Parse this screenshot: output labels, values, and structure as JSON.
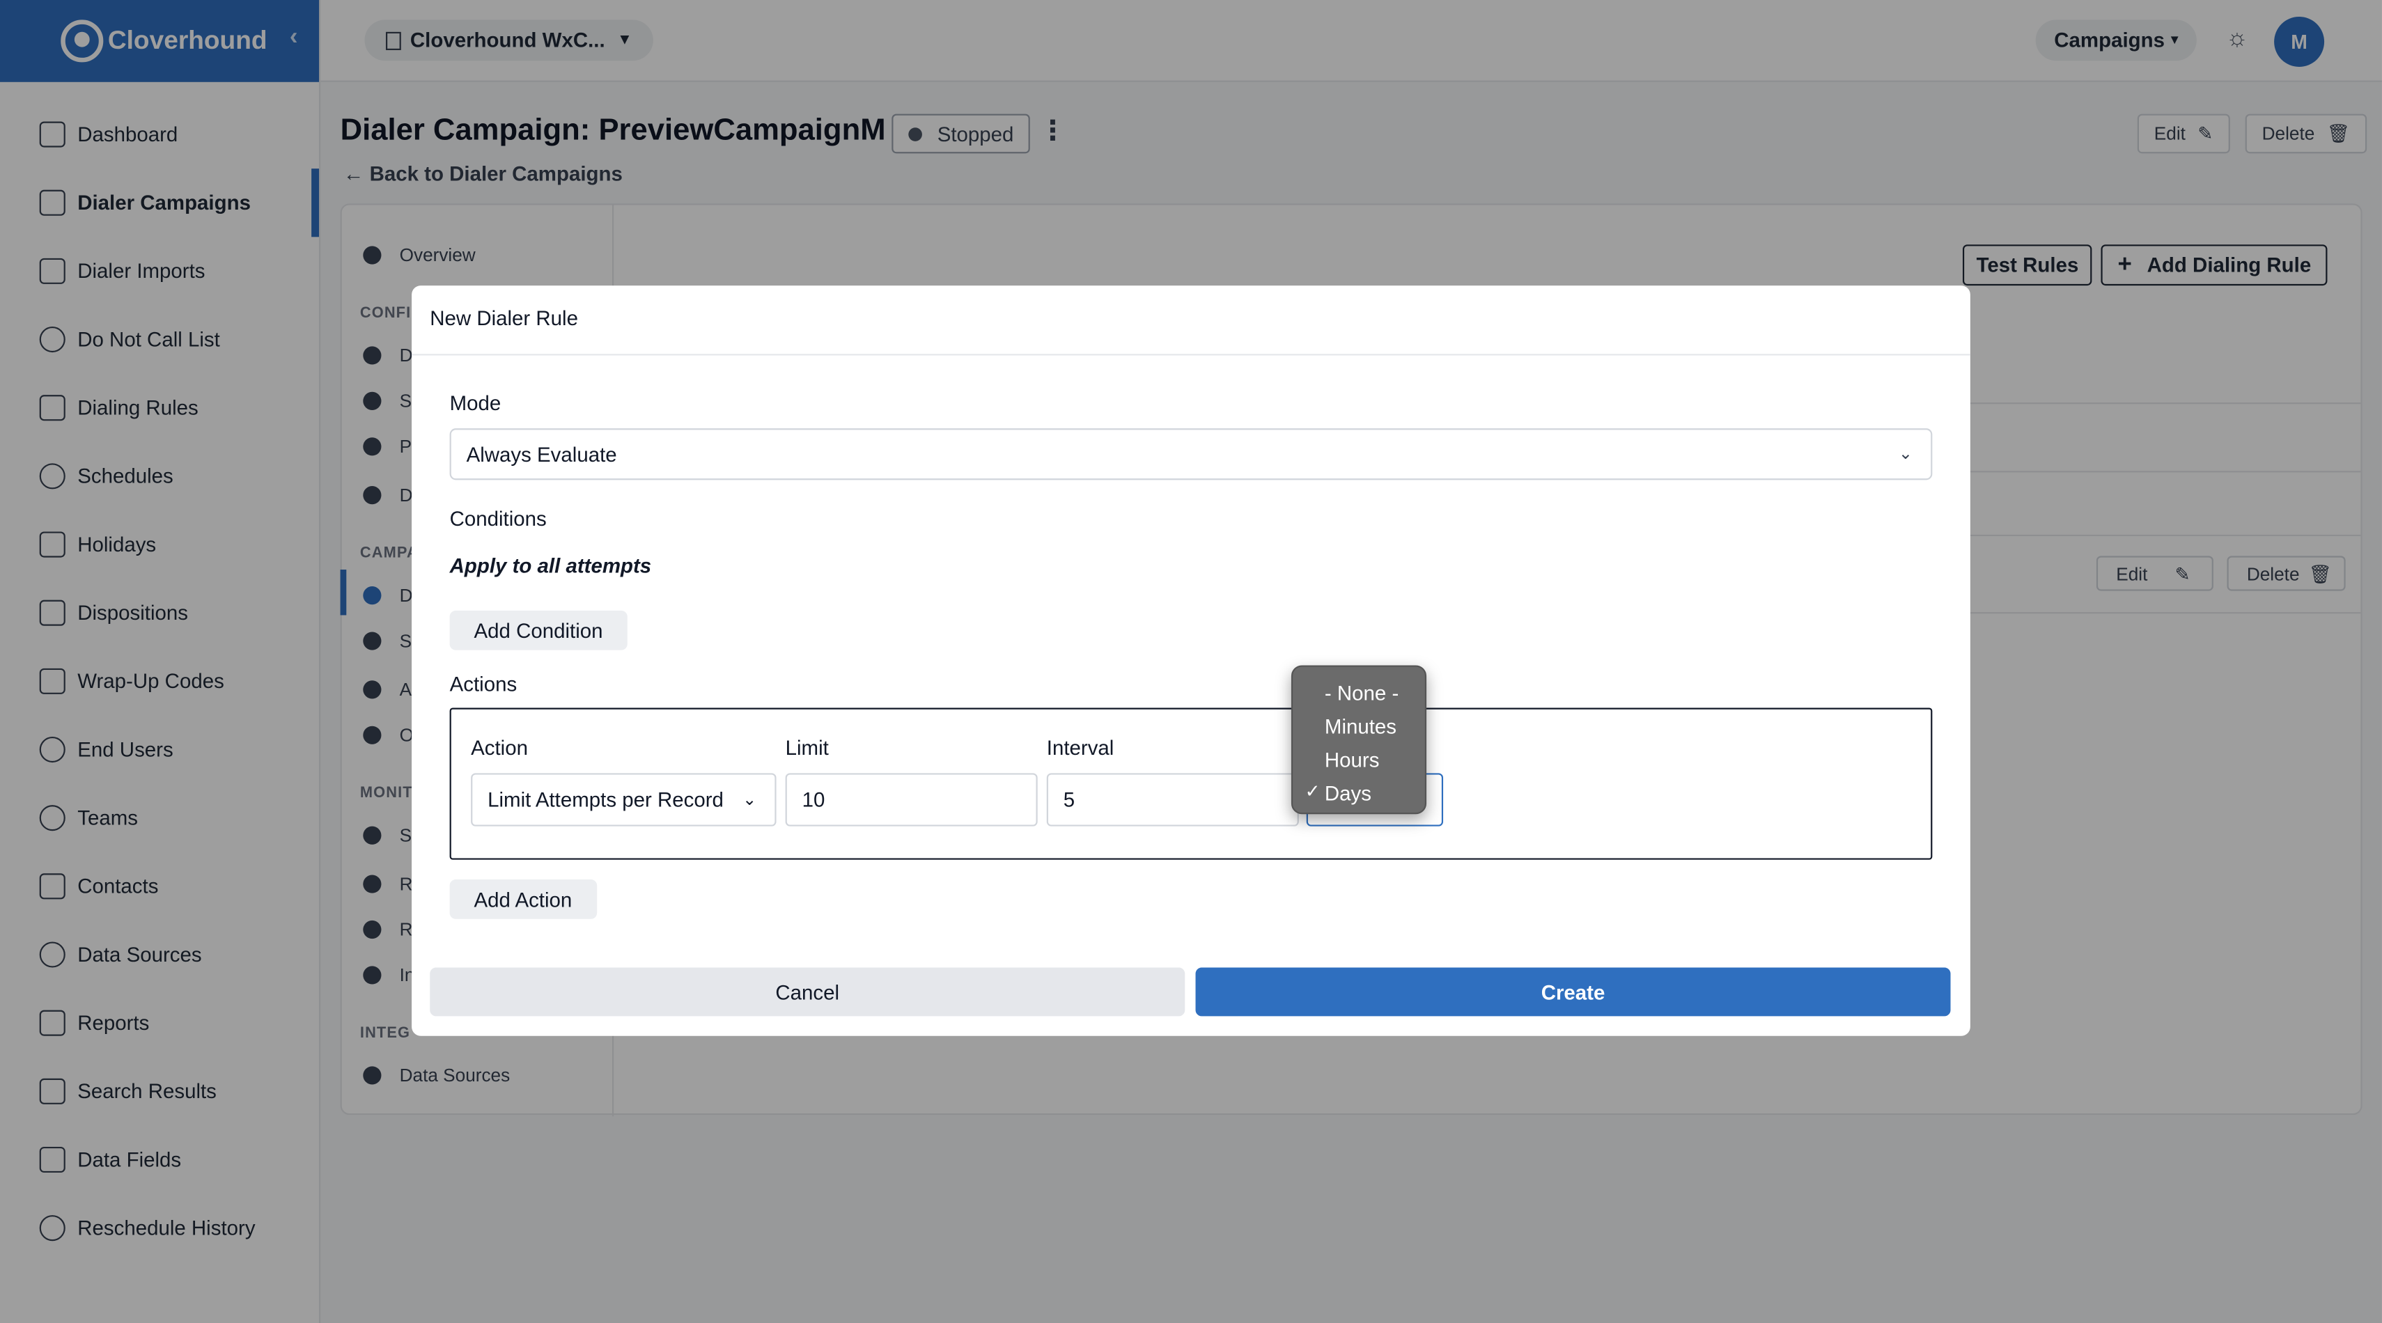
{
  "app": {
    "brand": "Cloverhound",
    "org_selector": "Cloverhound WxC...",
    "context_selector": "Campaigns",
    "avatar_initial": "M"
  },
  "sidebar": {
    "items": [
      {
        "label": "Dashboard",
        "icon": "chart-icon"
      },
      {
        "label": "Dialer Campaigns",
        "icon": "megaphone-icon",
        "active": true
      },
      {
        "label": "Dialer Imports",
        "icon": "import-icon"
      },
      {
        "label": "Do Not Call List",
        "icon": "ban-icon"
      },
      {
        "label": "Dialing Rules",
        "icon": "shield-icon"
      },
      {
        "label": "Schedules",
        "icon": "clock-icon"
      },
      {
        "label": "Holidays",
        "icon": "calendar-icon"
      },
      {
        "label": "Dispositions",
        "icon": "clipboard-icon"
      },
      {
        "label": "Wrap-Up Codes",
        "icon": "clipboard-check-icon"
      },
      {
        "label": "End Users",
        "icon": "headset-icon"
      },
      {
        "label": "Teams",
        "icon": "users-icon"
      },
      {
        "label": "Contacts",
        "icon": "contact-card-icon"
      },
      {
        "label": "Data Sources",
        "icon": "cloud-icon"
      },
      {
        "label": "Reports",
        "icon": "report-icon"
      },
      {
        "label": "Search Results",
        "icon": "search-document-icon"
      },
      {
        "label": "Data Fields",
        "icon": "table-icon"
      },
      {
        "label": "Reschedule History",
        "icon": "history-icon"
      }
    ]
  },
  "page": {
    "title": "Dialer Campaign: PreviewCampaignM",
    "status": "Stopped",
    "back_link": "Back to Dialer Campaigns",
    "edit_label": "Edit",
    "delete_label": "Delete"
  },
  "subnav": {
    "overview": "Overview",
    "sections": [
      "CONFI",
      "CAMPA",
      "MONIT",
      "INTEG"
    ],
    "partial_items": [
      "D",
      "S",
      "P",
      "D",
      "D",
      "S",
      "A",
      "O",
      "S",
      "R",
      "R",
      "In"
    ],
    "data_sources": "Data Sources"
  },
  "rules_panel": {
    "test_rules": "Test Rules",
    "add_rule": "Add Dialing Rule",
    "row_edit": "Edit",
    "row_delete": "Delete"
  },
  "modal": {
    "title": "New Dialer Rule",
    "mode_label": "Mode",
    "mode_value": "Always Evaluate",
    "conditions_label": "Conditions",
    "apply_note": "Apply to all attempts",
    "add_condition": "Add Condition",
    "actions_label": "Actions",
    "action_col": "Action",
    "limit_col": "Limit",
    "interval_col": "Interval",
    "action_value": "Limit Attempts per Record",
    "limit_value": "10",
    "interval_value": "5",
    "add_action": "Add Action",
    "cancel": "Cancel",
    "create": "Create"
  },
  "interval_unit_dropdown": {
    "options": [
      "- None -",
      "Minutes",
      "Hours",
      "Days"
    ],
    "selected": "Days",
    "checkmark": "✓"
  },
  "colors": {
    "accent": "#2f6fbf",
    "overlay": "rgba(0,0,0,0.38)",
    "dropdown_bg": "#6b6b6b"
  }
}
